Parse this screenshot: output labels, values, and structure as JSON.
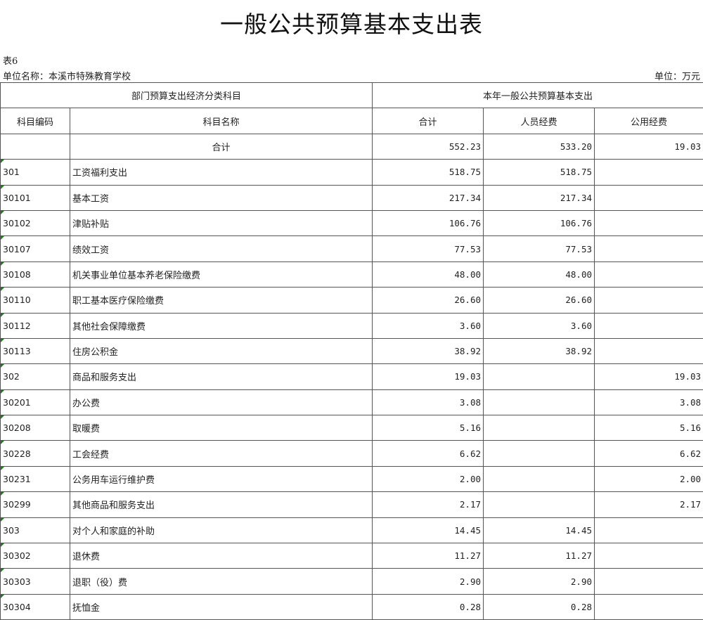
{
  "title": "一般公共预算基本支出表",
  "table_no": "表6",
  "unit_name": "单位名称：本溪市特殊教育学校",
  "unit": "单位：万元",
  "headers": {
    "group_left": "部门预算支出经济分类科目",
    "group_right": "本年一般公共预算基本支出",
    "code": "科目编码",
    "name": "科目名称",
    "total": "合计",
    "personnel": "人员经费",
    "public": "公用经费"
  },
  "total_row": {
    "name": "合计",
    "total": "552.23",
    "personnel": "533.20",
    "public": "19.03"
  },
  "rows": [
    {
      "code": "301",
      "name": "工资福利支出",
      "total": "518.75",
      "personnel": "518.75",
      "public": "",
      "level": 1
    },
    {
      "code": "30101",
      "name": "基本工资",
      "total": "217.34",
      "personnel": "217.34",
      "public": "",
      "level": 2
    },
    {
      "code": "30102",
      "name": "津贴补贴",
      "total": "106.76",
      "personnel": "106.76",
      "public": "",
      "level": 2
    },
    {
      "code": "30107",
      "name": "绩效工资",
      "total": "77.53",
      "personnel": "77.53",
      "public": "",
      "level": 2
    },
    {
      "code": "30108",
      "name": "机关事业单位基本养老保险缴费",
      "total": "48.00",
      "personnel": "48.00",
      "public": "",
      "level": 2
    },
    {
      "code": "30110",
      "name": "职工基本医疗保险缴费",
      "total": "26.60",
      "personnel": "26.60",
      "public": "",
      "level": 2
    },
    {
      "code": "30112",
      "name": "其他社会保障缴费",
      "total": "3.60",
      "personnel": "3.60",
      "public": "",
      "level": 2
    },
    {
      "code": "30113",
      "name": "住房公积金",
      "total": "38.92",
      "personnel": "38.92",
      "public": "",
      "level": 2
    },
    {
      "code": "302",
      "name": "商品和服务支出",
      "total": "19.03",
      "personnel": "",
      "public": "19.03",
      "level": 1
    },
    {
      "code": "30201",
      "name": "办公费",
      "total": "3.08",
      "personnel": "",
      "public": "3.08",
      "level": 2
    },
    {
      "code": "30208",
      "name": "取暖费",
      "total": "5.16",
      "personnel": "",
      "public": "5.16",
      "level": 2
    },
    {
      "code": "30228",
      "name": "工会经费",
      "total": "6.62",
      "personnel": "",
      "public": "6.62",
      "level": 2
    },
    {
      "code": "30231",
      "name": "公务用车运行维护费",
      "total": "2.00",
      "personnel": "",
      "public": "2.00",
      "level": 2
    },
    {
      "code": "30299",
      "name": "其他商品和服务支出",
      "total": "2.17",
      "personnel": "",
      "public": "2.17",
      "level": 2
    },
    {
      "code": "303",
      "name": "对个人和家庭的补助",
      "total": "14.45",
      "personnel": "14.45",
      "public": "",
      "level": 1
    },
    {
      "code": "30302",
      "name": "退休费",
      "total": "11.27",
      "personnel": "11.27",
      "public": "",
      "level": 2
    },
    {
      "code": "30303",
      "name": "退职（役）费",
      "total": "2.90",
      "personnel": "2.90",
      "public": "",
      "level": 2
    },
    {
      "code": "30304",
      "name": "抚恤金",
      "total": "0.28",
      "personnel": "0.28",
      "public": "",
      "level": 2
    }
  ],
  "colors": {
    "grid": "#555555",
    "cell_marker": "#1f7a1f",
    "text": "#222222"
  }
}
